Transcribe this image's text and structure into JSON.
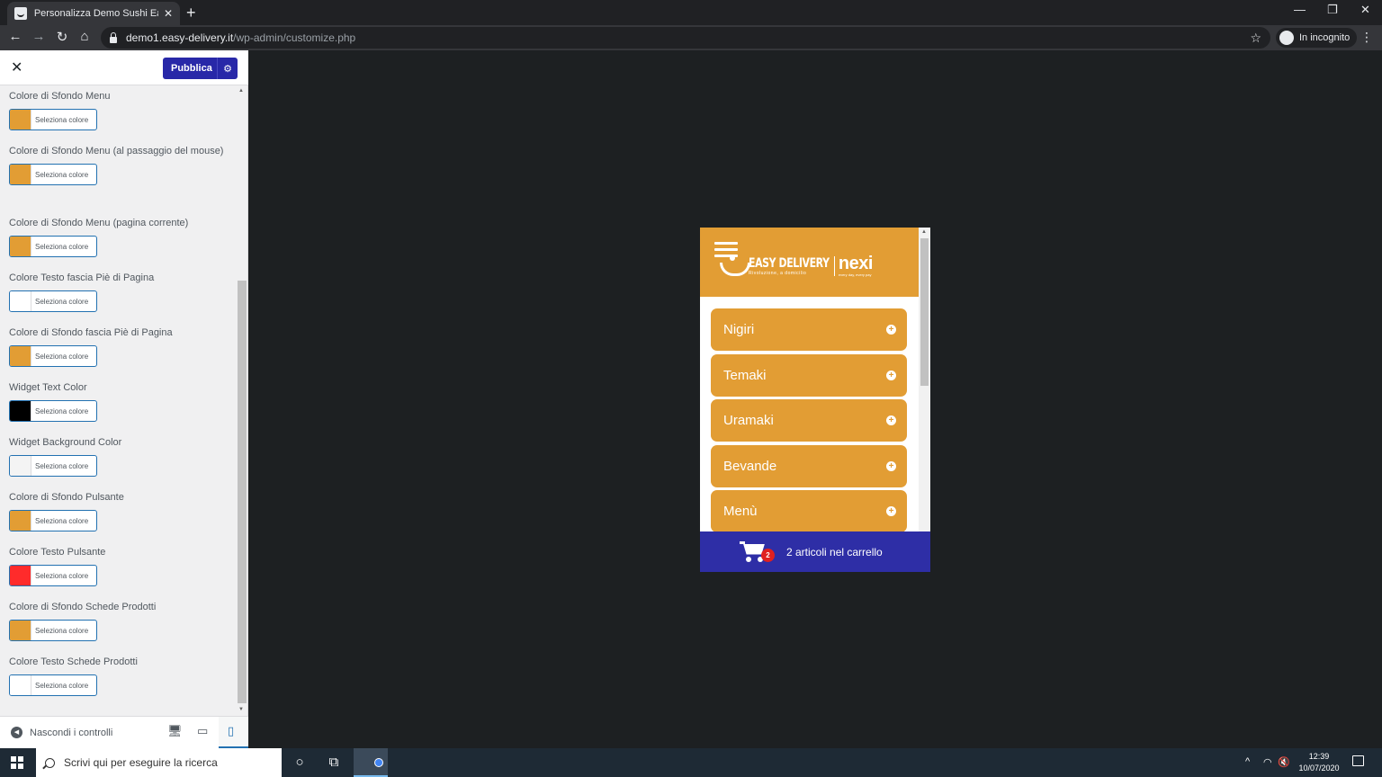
{
  "browser": {
    "tab_title": "Personalizza Demo Sushi Easy De",
    "tab_close": "✕",
    "new_tab": "+",
    "url_host": "demo1.easy-delivery.it",
    "url_path": "/wp-admin/customize.php",
    "incognito_label": "In incognito",
    "window_controls": {
      "minimize": "—",
      "restore": "❐",
      "close": "✕"
    },
    "nav": {
      "back": "←",
      "forward": "→",
      "reload": "↻",
      "home": "⌂",
      "star": "☆",
      "menu": "⋮"
    }
  },
  "customizer": {
    "close_glyph": "✕",
    "publish_label": "Pubblica",
    "publish_gear": "⚙",
    "controls": [
      {
        "label": "Colore di Sfondo Menu",
        "button": "Seleziona colore",
        "color": "#e29d34"
      },
      {
        "label": "Colore di Sfondo Menu (al passaggio del mouse)",
        "button": "Seleziona colore",
        "color": "#e29d34"
      },
      {
        "label": "Colore di Sfondo Menu (pagina corrente)",
        "button": "Seleziona colore",
        "color": "#e29d34"
      },
      {
        "label": "Colore Testo fascia Piè di Pagina",
        "button": "Seleziona colore",
        "color": "#ffffff"
      },
      {
        "label": "Colore di Sfondo fascia Piè di Pagina",
        "button": "Seleziona colore",
        "color": "#e29d34"
      },
      {
        "label": "Widget Text Color",
        "button": "Seleziona colore",
        "color": "#000000"
      },
      {
        "label": "Widget Background Color",
        "button": "Seleziona colore",
        "color": "#f4f4f4"
      },
      {
        "label": "Colore di Sfondo Pulsante",
        "button": "Seleziona colore",
        "color": "#e29d34"
      },
      {
        "label": "Colore Testo Pulsante",
        "button": "Seleziona colore",
        "color": "#ff2b2b"
      },
      {
        "label": "Colore di Sfondo Schede Prodotti",
        "button": "Seleziona colore",
        "color": "#e29d34"
      },
      {
        "label": "Colore Testo Schede Prodotti",
        "button": "Seleziona colore",
        "color": "#ffffff"
      }
    ],
    "hide_controls_label": "Nascondi i controlli",
    "devices": {
      "desktop": "🖥",
      "tablet": "▭",
      "mobile": "▯"
    }
  },
  "preview": {
    "logo_main": "EASY DELIVERY",
    "logo_sub": "Rivoluzione, a domicilio",
    "logo_partner": "nexi",
    "logo_partner_sub": "every day, every pay",
    "categories": [
      "Nigiri",
      "Temaki",
      "Uramaki",
      "Bevande",
      "Menù"
    ],
    "plus_glyph": "+",
    "cart_count": "2",
    "cart_text": "2 articoli nel carrello",
    "colors": {
      "accent": "#e29d34",
      "cart_bar": "#2e2ea6"
    }
  },
  "taskbar": {
    "search_placeholder": "Scrivi qui per eseguire la ricerca",
    "cortana": "○",
    "taskview": "⧉",
    "tray_arrow": "^",
    "tray_network": "◠",
    "tray_volume": "🔇",
    "time": "12:39",
    "date": "10/07/2020"
  }
}
